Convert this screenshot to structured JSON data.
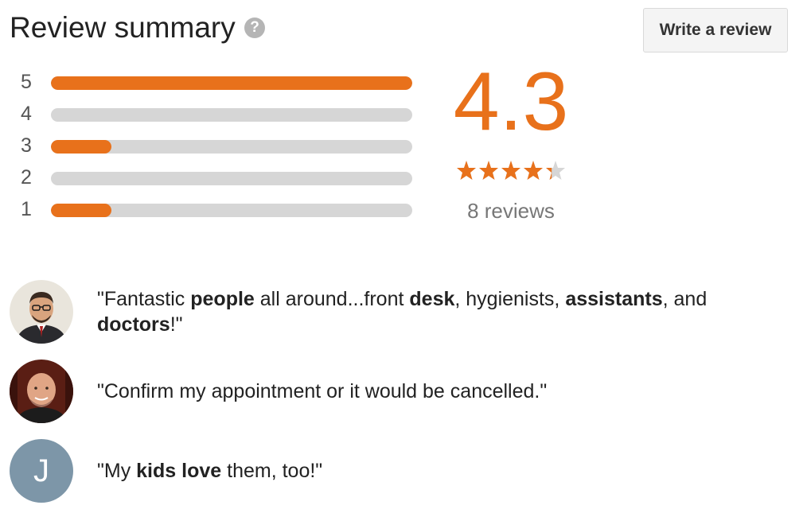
{
  "header": {
    "title": "Review summary",
    "help_icon_glyph": "?",
    "write_review_label": "Write a review"
  },
  "distribution": [
    {
      "label": "5",
      "fraction": 1.0
    },
    {
      "label": "4",
      "fraction": 0.0
    },
    {
      "label": "3",
      "fraction": 0.167
    },
    {
      "label": "2",
      "fraction": 0.0
    },
    {
      "label": "1",
      "fraction": 0.167
    }
  ],
  "summary": {
    "average": "4.3",
    "stars_value": 4.3,
    "stars_max": 5,
    "review_count_text": "8 reviews"
  },
  "reviews": [
    {
      "avatar_icon": "person-photo-glasses-icon",
      "segments": [
        {
          "text": "\"Fantastic ",
          "bold": false
        },
        {
          "text": "people",
          "bold": true
        },
        {
          "text": " all around...front ",
          "bold": false
        },
        {
          "text": "desk",
          "bold": true
        },
        {
          "text": ", hygienists, ",
          "bold": false
        },
        {
          "text": "assistants",
          "bold": true
        },
        {
          "text": ", and ",
          "bold": false
        },
        {
          "text": "doctors",
          "bold": true
        },
        {
          "text": "!\"",
          "bold": false
        }
      ]
    },
    {
      "avatar_icon": "person-photo-bald-icon",
      "segments": [
        {
          "text": "\"Confirm my appointment or it would be cancelled.\"",
          "bold": false
        }
      ]
    },
    {
      "avatar_icon": "initial-avatar-icon",
      "avatar_initial": "J",
      "segments": [
        {
          "text": "\"My ",
          "bold": false
        },
        {
          "text": "kids",
          "bold": true
        },
        {
          "text": " ",
          "bold": false
        },
        {
          "text": "love",
          "bold": true
        },
        {
          "text": " them, too!\"",
          "bold": false
        }
      ]
    }
  ],
  "colors": {
    "accent": "#e8711b",
    "track": "#d6d6d6",
    "initial_avatar_bg": "#7d96a8"
  }
}
